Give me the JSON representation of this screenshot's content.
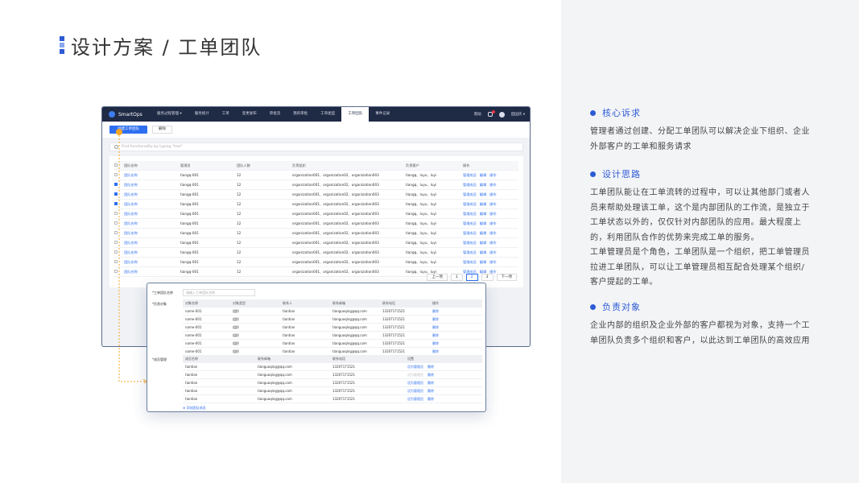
{
  "page": {
    "title": "设计方案 / 工单团队"
  },
  "sections": [
    {
      "title": "核心诉求",
      "lines": [
        "管理者通过创建、分配工单团队可以解决企业下组织、企业",
        "外部客户的工单和服务请求"
      ]
    },
    {
      "title": "设计思路",
      "lines": [
        "工单团队能让在工单流转的过程中，可以让其他部门或者人",
        "员来帮助处理该工单，这个是内部团队的工作流，是独立于",
        "工单状态以外的，仅仅针对内部团队的应用。最大程度上",
        "的，利用团队合作的优势来完成工单的服务。",
        "工单管理员是个角色，工单团队是一个组织，把工单管理员",
        "拉进工单团队，可以让工单管理员相互配合处理某个组织/",
        "客户提起的工单。"
      ]
    },
    {
      "title": "负责对象",
      "lines": [
        "企业内部的组织及企业外部的客户都视为对象，支持一个工",
        "单团队负责多个组织和客户，以此达到工单团队的高效应用"
      ]
    }
  ],
  "app": {
    "brand": "SmartOps",
    "nav": [
      "服务过程管理 ▾",
      "服务统计",
      "工单",
      "变更发布",
      "审批流",
      "我的审批",
      "工单类型",
      "工单团队",
      "事件记录"
    ],
    "active_nav": "工单团队",
    "help": "帮助",
    "user": "田国庆 ▾",
    "toolbar": {
      "create": "创建工单团队",
      "delete": "删除"
    },
    "search_placeholder": "Find functionality by typing \"tree\"",
    "table": {
      "headers": [
        "团队名称",
        "管理员",
        "团队人数",
        "负责组织",
        "负责客户",
        "操作"
      ],
      "rows": [
        {
          "name": "团队名称",
          "admin": "tiangq-001",
          "count": "12",
          "orgs": "organization001、organization02、organization003",
          "customers": "tiangq、luyu、luyi",
          "checked": false
        },
        {
          "name": "团队名称",
          "admin": "tiangq-001",
          "count": "12",
          "orgs": "organization001、organization02、organization003",
          "customers": "tiangq、luyu、luyi",
          "checked": true
        },
        {
          "name": "团队名称",
          "admin": "tiangq-001",
          "count": "12",
          "orgs": "organization001、organization02、organization003",
          "customers": "tiangq、luyu、luyi",
          "checked": true
        },
        {
          "name": "团队名称",
          "admin": "tiangq-001",
          "count": "12",
          "orgs": "organization001、organization02、organization003",
          "customers": "tiangq、luyu、luyi",
          "checked": true
        },
        {
          "name": "团队名称",
          "admin": "tiangq-001",
          "count": "12",
          "orgs": "organization001、organization02、organization003",
          "customers": "tiangq、luyu、luyi",
          "checked": false
        },
        {
          "name": "团队名称",
          "admin": "tiangq-001",
          "count": "12",
          "orgs": "organization001、organization02、organization003",
          "customers": "tiangq、luyu、luyi",
          "checked": false
        },
        {
          "name": "团队名称",
          "admin": "tiangq-001",
          "count": "12",
          "orgs": "organization001、organization02、organization003",
          "customers": "tiangq、luyu、luyi",
          "checked": false
        },
        {
          "name": "团队名称",
          "admin": "tiangq-001",
          "count": "12",
          "orgs": "organization001、organization02、organization003",
          "customers": "tiangq、luyu、luyi",
          "checked": false
        },
        {
          "name": "团队名称",
          "admin": "tiangq-001",
          "count": "12",
          "orgs": "organization001、organization02、organization003",
          "customers": "tiangq、luyu、luyi",
          "checked": false
        },
        {
          "name": "团队名称",
          "admin": "tiangq-001",
          "count": "12",
          "orgs": "organization001、organization02、organization003",
          "customers": "tiangq、luyu、luyi",
          "checked": false
        },
        {
          "name": "团队名称",
          "admin": "tiangq-001",
          "count": "12",
          "orgs": "organization001、organization02、organization003",
          "customers": "tiangq、luyu、luyi",
          "checked": false
        }
      ],
      "ops": [
        "管理成员",
        "编辑",
        "操作"
      ]
    },
    "pager": [
      "上一项",
      "1",
      "2",
      "3",
      "下一项"
    ],
    "current_page": "2"
  },
  "detail": {
    "name_label": "*工单团队名称",
    "name_placeholder": "请输入工单团队名称",
    "objects_label": "*负责对象",
    "objects_headers": [
      "对象名称",
      "对象类型",
      "联系人",
      "联系邮箱",
      "联系电话",
      "操作"
    ],
    "objects_rows": [
      [
        "name-001",
        "组织",
        "tiantian",
        "tianguoqing@qq.com",
        "13207171521",
        "删除"
      ],
      [
        "name-001",
        "组织",
        "tiantian",
        "tianguoqing@qq.com",
        "13207171521",
        "删除"
      ],
      [
        "name-001",
        "组织",
        "tiantian",
        "tianguoqing@qq.com",
        "13207171521",
        "删除"
      ],
      [
        "name-001",
        "组织",
        "tiantian",
        "tianguoqing@qq.com",
        "13207171521",
        "删除"
      ],
      [
        "name-001",
        "组织",
        "tiantian",
        "tianguoqing@qq.com",
        "13207171521",
        "删除"
      ],
      [
        "name-001",
        "组织",
        "tiantian",
        "tianguoqing@qq.com",
        "13207171521",
        "删除"
      ]
    ],
    "objects_add": "⊕ 添加负责对象",
    "members_label": "*成员管理",
    "members_headers": [
      "成员名称",
      "联系邮箱",
      "联系电话",
      "设置"
    ],
    "members_rows": [
      {
        "name": "tiantian",
        "email": "tianguoqing@qq.com",
        "phone": "13207171521",
        "set": "设为管理员",
        "del": "删除",
        "grey": false
      },
      {
        "name": "tiantian",
        "email": "tianguoqing@qq.com",
        "phone": "13207171521",
        "set": "设为管理员",
        "del": "删除",
        "grey": true
      },
      {
        "name": "tiantian",
        "email": "tianguoqing@qq.com",
        "phone": "13207171521",
        "set": "设为管理员",
        "del": "删除",
        "grey": false
      },
      {
        "name": "tiantian",
        "email": "tianguoqing@qq.com",
        "phone": "13207171521",
        "set": "设为管理员",
        "del": "删除",
        "grey": false
      },
      {
        "name": "tiantian",
        "email": "tianguoqing@qq.com",
        "phone": "13207171521",
        "set": "设为管理员",
        "del": "删除",
        "grey": false
      }
    ],
    "members_add": "⊕ 添加团队成员"
  },
  "colors": {
    "accent": "#2d5bd6",
    "primary_button": "#2d6ff0",
    "topbar": "#1f2a44",
    "connector": "#f5a623"
  }
}
